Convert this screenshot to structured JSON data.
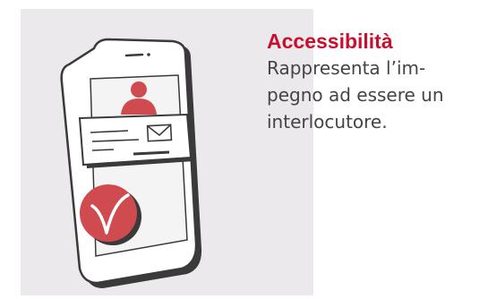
{
  "card": {
    "title": "Accessibilità",
    "lines": [
      "Rappresenta l’im-",
      "pegno ad essere un",
      "interlocutore."
    ]
  },
  "illustration": {
    "icons": [
      "smartphone-icon",
      "user-icon",
      "envelope-icon",
      "checkmark-icon"
    ]
  },
  "colors": {
    "accent_red": "#c8102e",
    "icon_red": "#cf4b4f",
    "body_text": "#444444",
    "panel_bg": "#ebe9eb"
  }
}
